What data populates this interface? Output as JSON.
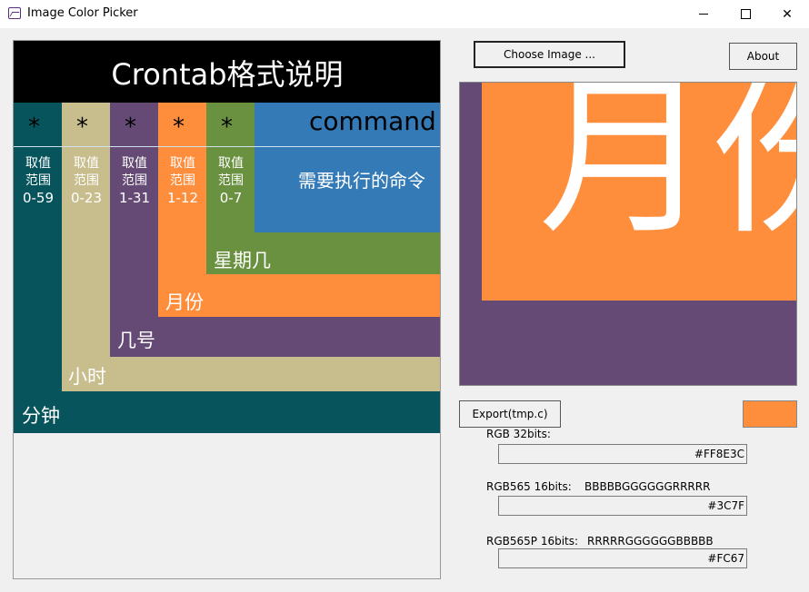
{
  "window": {
    "title": "Image Color Picker",
    "controls": {
      "minimize": "─",
      "maximize": "☐",
      "close": "✕"
    }
  },
  "image_view": {
    "title": "Crontab格式说明",
    "stars": [
      "*",
      "*",
      "*",
      "*",
      "*"
    ],
    "command_label": "command",
    "command_desc": "需要执行的命令",
    "ranges": [
      {
        "line1": "取值",
        "line2": "范围",
        "line3": "0-59"
      },
      {
        "line1": "取值",
        "line2": "范围",
        "line3": "0-23"
      },
      {
        "line1": "取值",
        "line2": "范围",
        "line3": "1-31"
      },
      {
        "line1": "取值",
        "line2": "范围",
        "line3": "1-12"
      },
      {
        "line1": "取值",
        "line2": "范围",
        "line3": "0-7"
      }
    ],
    "field_labels": {
      "weekday": "星期几",
      "month": "月份",
      "day": "几号",
      "hour": "小时",
      "minute": "分钟"
    },
    "colors": {
      "minute": "#07545c",
      "hour": "#c8bd8d",
      "day": "#644a74",
      "month": "#ff8e3c",
      "weekday": "#6a9140",
      "command": "#337ab7"
    }
  },
  "buttons": {
    "choose_image": "Choose Image ...",
    "about": "About",
    "export": "Export(tmp.c)"
  },
  "zoom_view": {
    "text": "月份",
    "colors": {
      "background": "#644a74",
      "highlight": "#ff8e3c"
    }
  },
  "picked_color": {
    "swatch": "#FF8E3C",
    "rgb32_label": "RGB 32bits:",
    "rgb32_value": "#FF8E3C",
    "rgb565_label": "RGB565 16bits:",
    "rgb565_format": "BBBBBGGGGGGRRRRR",
    "rgb565_value": "#3C7F",
    "rgb565p_label": "RGB565P 16bits:",
    "rgb565p_format": "RRRRRGGGGGGBBBBB",
    "rgb565p_value": "#FC67"
  }
}
